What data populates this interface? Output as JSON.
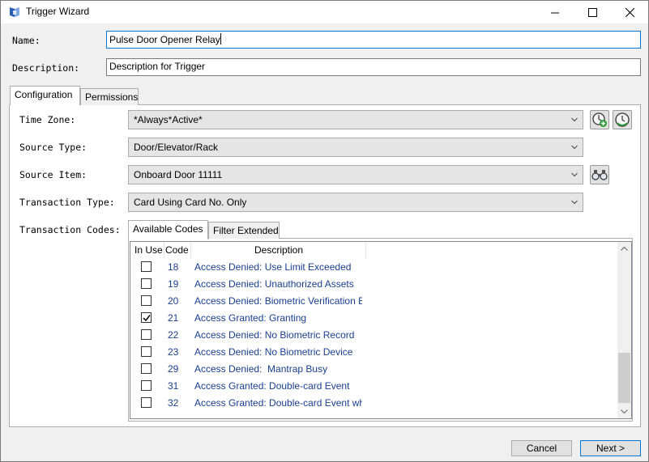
{
  "window": {
    "title": "Trigger Wizard"
  },
  "form": {
    "name_label": "Name:",
    "name_value": "Pulse Door Opener Relay",
    "description_label": "Description:",
    "description_value": "Description for Trigger"
  },
  "tabs": [
    {
      "label": "Configuration",
      "active": true
    },
    {
      "label": "Permissions",
      "active": false
    }
  ],
  "config": {
    "time_zone": {
      "label": "Time Zone:",
      "value": "*Always*Active*"
    },
    "source_type": {
      "label": "Source Type:",
      "value": "Door/Elevator/Rack"
    },
    "source_item": {
      "label": "Source Item:",
      "value": "Onboard Door 11111"
    },
    "transaction_type": {
      "label": "Transaction Type:",
      "value": "Card Using Card No. Only"
    },
    "transaction_codes_label": "Transaction Codes:"
  },
  "code_tabs": [
    {
      "label": "Available Codes",
      "active": true
    },
    {
      "label": "Filter Extended",
      "active": false
    }
  ],
  "code_list": {
    "headers": {
      "in_use": "In Use",
      "code": "Code",
      "description": "Description"
    },
    "rows": [
      {
        "in_use": false,
        "code": "18",
        "description": "Access Denied: Use Limit Exceeded"
      },
      {
        "in_use": false,
        "code": "19",
        "description": "Access Denied: Unauthorized Assets"
      },
      {
        "in_use": false,
        "code": "20",
        "description": "Access Denied: Biometric Verification Error"
      },
      {
        "in_use": true,
        "code": "21",
        "description": "Access Granted: Granting"
      },
      {
        "in_use": false,
        "code": "22",
        "description": "Access Denied: No Biometric Record"
      },
      {
        "in_use": false,
        "code": "23",
        "description": "Access Denied: No Biometric Device"
      },
      {
        "in_use": false,
        "code": "29",
        "description": "Access Denied:  Mantrap Busy"
      },
      {
        "in_use": false,
        "code": "31",
        "description": "Access Granted: Double-card Event"
      },
      {
        "in_use": false,
        "code": "32",
        "description": "Access Granted: Double-card Event while"
      }
    ]
  },
  "buttons": {
    "cancel": "Cancel",
    "next": "Next >"
  },
  "colors": {
    "accent": "#0078d7",
    "code_text": "#1a3f8f",
    "dialog_bg": "#f0f0f0"
  },
  "icons": [
    "app-icon",
    "minimize-icon",
    "maximize-icon",
    "close-icon",
    "add-time-zone-icon",
    "time-zone-clock-icon",
    "binoculars-icon"
  ]
}
